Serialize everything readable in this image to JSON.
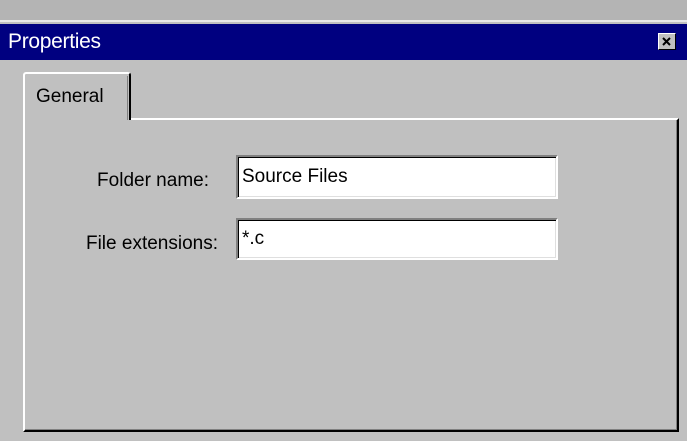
{
  "window": {
    "title": "Properties",
    "close_icon": "close-x-icon"
  },
  "tabs": [
    {
      "label": "General",
      "active": true
    }
  ],
  "form": {
    "folder_name": {
      "label": "Folder name:",
      "value": "Source Files"
    },
    "file_extensions": {
      "label": "File extensions:",
      "value": "*.c"
    }
  },
  "colors": {
    "titlebar": "#000080",
    "face": "#c0c0c0",
    "field_bg": "#ffffff"
  }
}
